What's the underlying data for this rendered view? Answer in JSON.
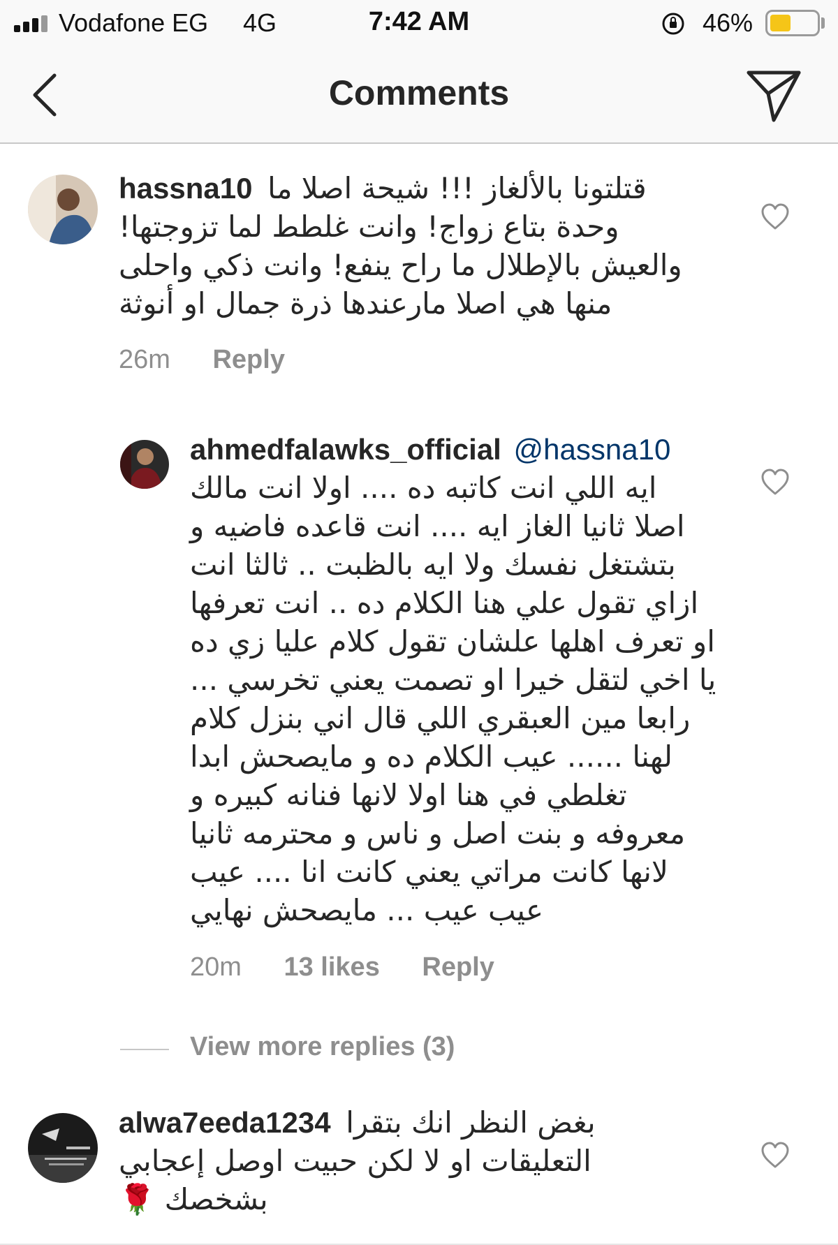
{
  "status_bar": {
    "carrier": "Vodafone EG",
    "network": "4G",
    "time": "7:42 AM",
    "battery_percent": "46%",
    "battery_level": 0.46,
    "signal_bars": 4,
    "icons": [
      "signal-icon",
      "orientation-lock-icon",
      "battery-icon"
    ]
  },
  "nav": {
    "title": "Comments",
    "back_icon": "chevron-left-icon",
    "share_icon": "paper-plane-icon"
  },
  "comments": [
    {
      "username": "hassna10",
      "first_line": "قتلتونا بالألغاز !!! شيحة اصلا ما",
      "text": "وحدة بتاع زواج! وانت غلطط لما تزوجتها!\nوالعيش بالإطلال ما راح ينفع! وانت ذكي واحلى\nمنها هي اصلا مارعندها ذرة جمال او أنوثة",
      "time": "26m",
      "reply": "Reply"
    },
    {
      "username": "ahmedfalawks_official",
      "mention": "@hassna10",
      "text": "ايه اللي انت كاتبه ده .... اولا انت مالك\nاصلا ثانيا الغاز ايه .... انت قاعده فاضيه و\nبتشتغل نفسك ولا ايه بالظبت .. ثالثا انت\nازاي تقول علي هنا الكلام ده .. انت تعرفها\nاو تعرف اهلها علشان تقول كلام عليا زي ده\nيا اخي لتقل خيرا او تصمت يعني تخرسي ...\nرابعا مين العبقري اللي قال اني بنزل كلام\nلهنا ...... عيب الكلام ده و مايصحش ابدا\nتغلطي في هنا اولا لانها فنانه كبيره و\nمعروفه و بنت اصل و ناس و محترمه ثانيا\nلانها كانت مراتي يعني كانت انا .... عيب\nعيب عيب ... مايصحش نهايي",
      "time": "20m",
      "likes": "13 likes",
      "reply": "Reply"
    },
    {
      "username": "alwa7eeda1234",
      "first_line": "بغض النظر انك بتقرا",
      "text": "التعليقات او لا لكن حبيت اوصل إعجابي\nبشخصك 🌹",
      "time": "",
      "reply": ""
    }
  ],
  "view_more_replies": "View more replies (3)"
}
